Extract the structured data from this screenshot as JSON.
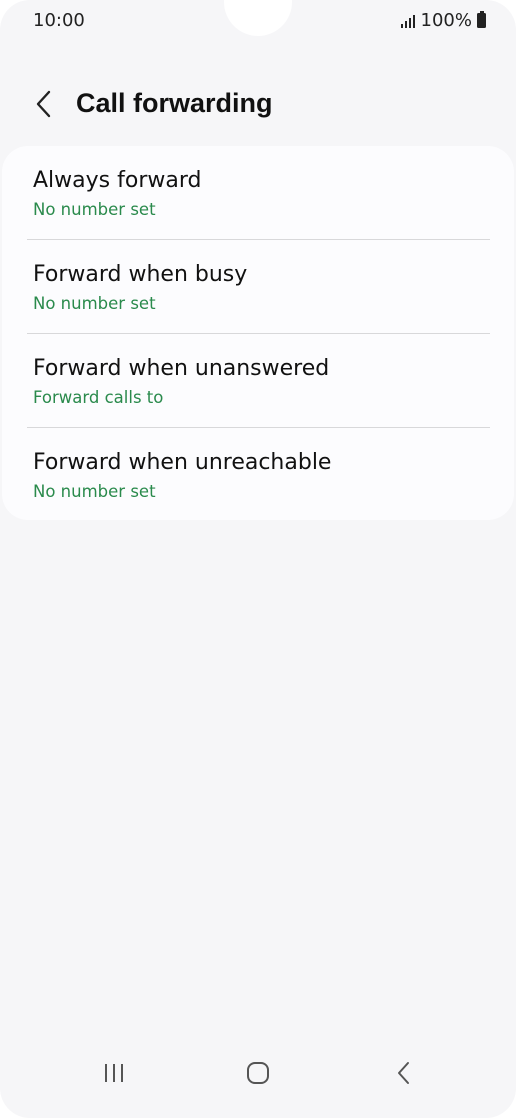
{
  "status_bar": {
    "time": "10:00",
    "battery": "100%"
  },
  "header": {
    "title": "Call forwarding"
  },
  "list": {
    "items": [
      {
        "title": "Always forward",
        "subtitle": "No number set"
      },
      {
        "title": "Forward when busy",
        "subtitle": "No number set"
      },
      {
        "title": "Forward when unanswered",
        "subtitle": "Forward calls to"
      },
      {
        "title": "Forward when unreachable",
        "subtitle": "No number set"
      }
    ]
  },
  "colors": {
    "accent_green": "#2a8a4c",
    "background": "#f6f6f8",
    "card": "#fcfcfe"
  },
  "icons": {
    "back": "chevron-left-icon",
    "recents": "recent-apps-icon",
    "home": "home-icon",
    "nav_back": "nav-back-icon"
  }
}
